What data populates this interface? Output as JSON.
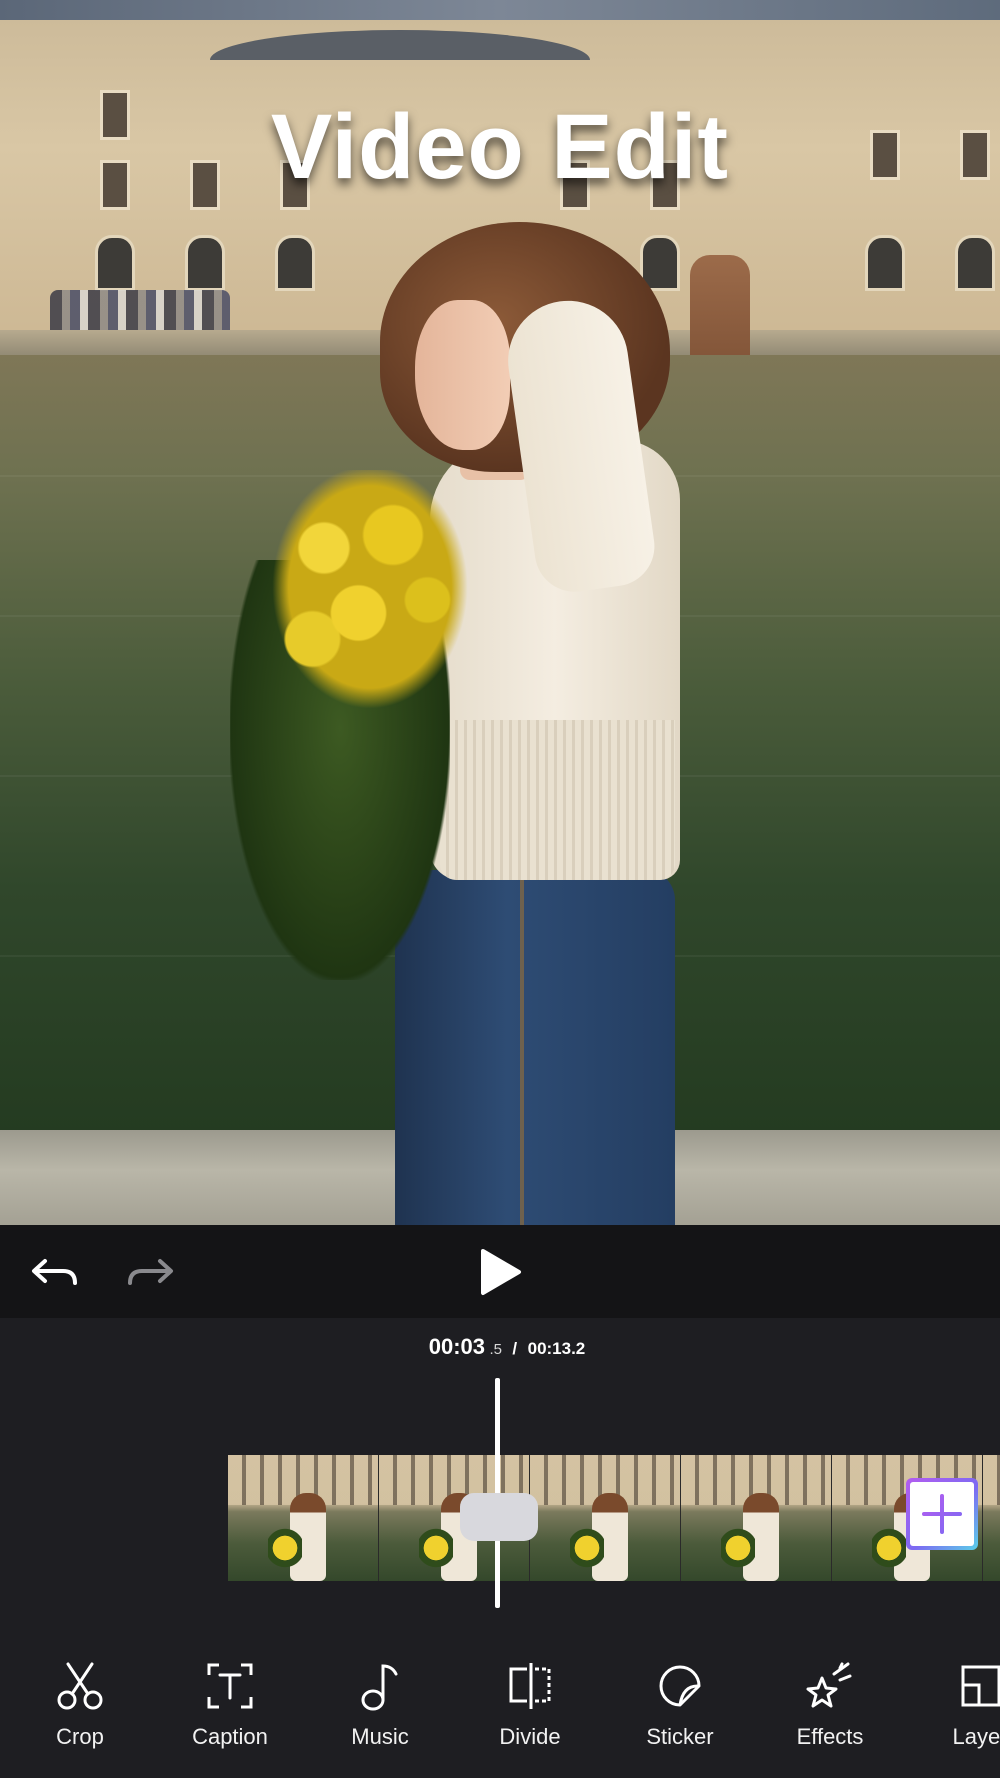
{
  "preview": {
    "overlay_title": "Video Edit"
  },
  "controls": {
    "undo_icon": "undo-arrow-icon",
    "redo_icon": "redo-arrow-icon",
    "play_icon": "play-icon"
  },
  "timeline": {
    "current_time": "00:03",
    "current_fraction": ".5",
    "separator": "/",
    "total_time": "00:13.2",
    "add_clip_icon": "plus-icon",
    "accent_gradient": [
      "#b45cf0",
      "#7c6af2",
      "#5ad0e8"
    ]
  },
  "toolbar": {
    "tools": [
      {
        "label": "Crop",
        "icon": "scissors-icon"
      },
      {
        "label": "Caption",
        "icon": "text-box-icon"
      },
      {
        "label": "Music",
        "icon": "music-note-icon"
      },
      {
        "label": "Divide",
        "icon": "split-icon"
      },
      {
        "label": "Sticker",
        "icon": "sticker-icon"
      },
      {
        "label": "Effects",
        "icon": "sparkle-star-icon"
      },
      {
        "label": "Layer",
        "icon": "layer-icon"
      }
    ]
  }
}
